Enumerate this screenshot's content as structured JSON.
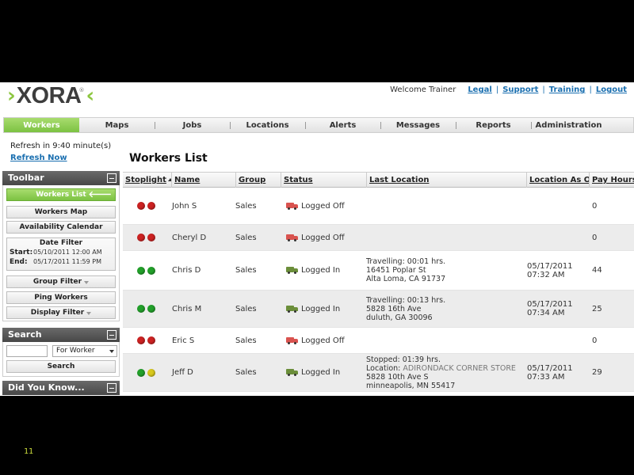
{
  "header": {
    "logo": {
      "left_mark": "›",
      "text": "XORA",
      "registered": "®",
      "right_mark": "‹"
    },
    "welcome": "Welcome Trainer",
    "links": [
      "Legal",
      "Support",
      "Training",
      "Logout"
    ]
  },
  "nav": {
    "active": "Workers",
    "items": [
      "Workers",
      "Maps",
      "Jobs",
      "Locations",
      "Alerts",
      "Messages",
      "Reports",
      "Administration"
    ]
  },
  "refresh": {
    "text": "Refresh in 9:40 minute(s)",
    "link": "Refresh Now"
  },
  "toolbar": {
    "title": "Toolbar",
    "workers_list": "Workers List",
    "workers_map": "Workers Map",
    "availability_calendar": "Availability Calendar",
    "date_filter": {
      "title": "Date Filter",
      "start_label": "Start:",
      "start_value": "05/10/2011  12:00 AM",
      "end_label": "End:",
      "end_value": "05/17/2011  11:59 PM"
    },
    "group_filter": "Group Filter",
    "ping_workers": "Ping Workers",
    "display_filter": "Display Filter"
  },
  "search": {
    "title": "Search",
    "input_value": "",
    "select_value": "For Worker",
    "button": "Search"
  },
  "did_you_know": {
    "title": "Did You Know..."
  },
  "main": {
    "title": "Workers List",
    "columns": [
      "Stoplight",
      "Name",
      "Group",
      "Status",
      "Last Location",
      "Location As Of",
      "Pay Hours"
    ],
    "rows": [
      {
        "lights": [
          "#cc2222",
          "#cc2222"
        ],
        "name": "John S",
        "group": "Sales",
        "status": "Logged Off",
        "status_color": "#d9534f",
        "loc": [],
        "loc_as_of": [],
        "pay_hours": "0"
      },
      {
        "lights": [
          "#cc2222",
          "#cc2222"
        ],
        "name": "Cheryl D",
        "group": "Sales",
        "status": "Logged Off",
        "status_color": "#d9534f",
        "loc": [],
        "loc_as_of": [],
        "pay_hours": "0"
      },
      {
        "lights": [
          "#22a02a",
          "#22a02a"
        ],
        "name": "Chris D",
        "group": "Sales",
        "status": "Logged In",
        "status_color": "#6b8e3a",
        "loc": [
          "Travelling: 00:01 hrs.",
          "16451 Poplar St",
          "Alta Loma, CA 91737"
        ],
        "loc_as_of": [
          "05/17/2011",
          "07:32 AM"
        ],
        "pay_hours": "44"
      },
      {
        "lights": [
          "#22a02a",
          "#22a02a"
        ],
        "name": "Chris M",
        "group": "Sales",
        "status": "Logged In",
        "status_color": "#6b8e3a",
        "loc": [
          "Travelling: 00:13 hrs.",
          "5828 16th Ave",
          "duluth, GA 30096"
        ],
        "loc_as_of": [
          "05/17/2011",
          "07:34 AM"
        ],
        "pay_hours": "25"
      },
      {
        "lights": [
          "#cc2222",
          "#cc2222"
        ],
        "name": "Eric S",
        "group": "Sales",
        "status": "Logged Off",
        "status_color": "#d9534f",
        "loc": [],
        "loc_as_of": [],
        "pay_hours": "0"
      },
      {
        "lights": [
          "#22a02a",
          "#d8c81c"
        ],
        "name": "Jeff D",
        "group": "Sales",
        "status": "Logged In",
        "status_color": "#6b8e3a",
        "loc": [
          "Stopped: 01:39 hrs.",
          "Location: ",
          "ADIRONDACK CORNER STORE",
          "5828 10th Ave S",
          "minneapolis, MN 55417"
        ],
        "loc_as_of": [
          "05/17/2011",
          "07:33 AM"
        ],
        "pay_hours": "29"
      }
    ]
  },
  "slide_number": "11"
}
